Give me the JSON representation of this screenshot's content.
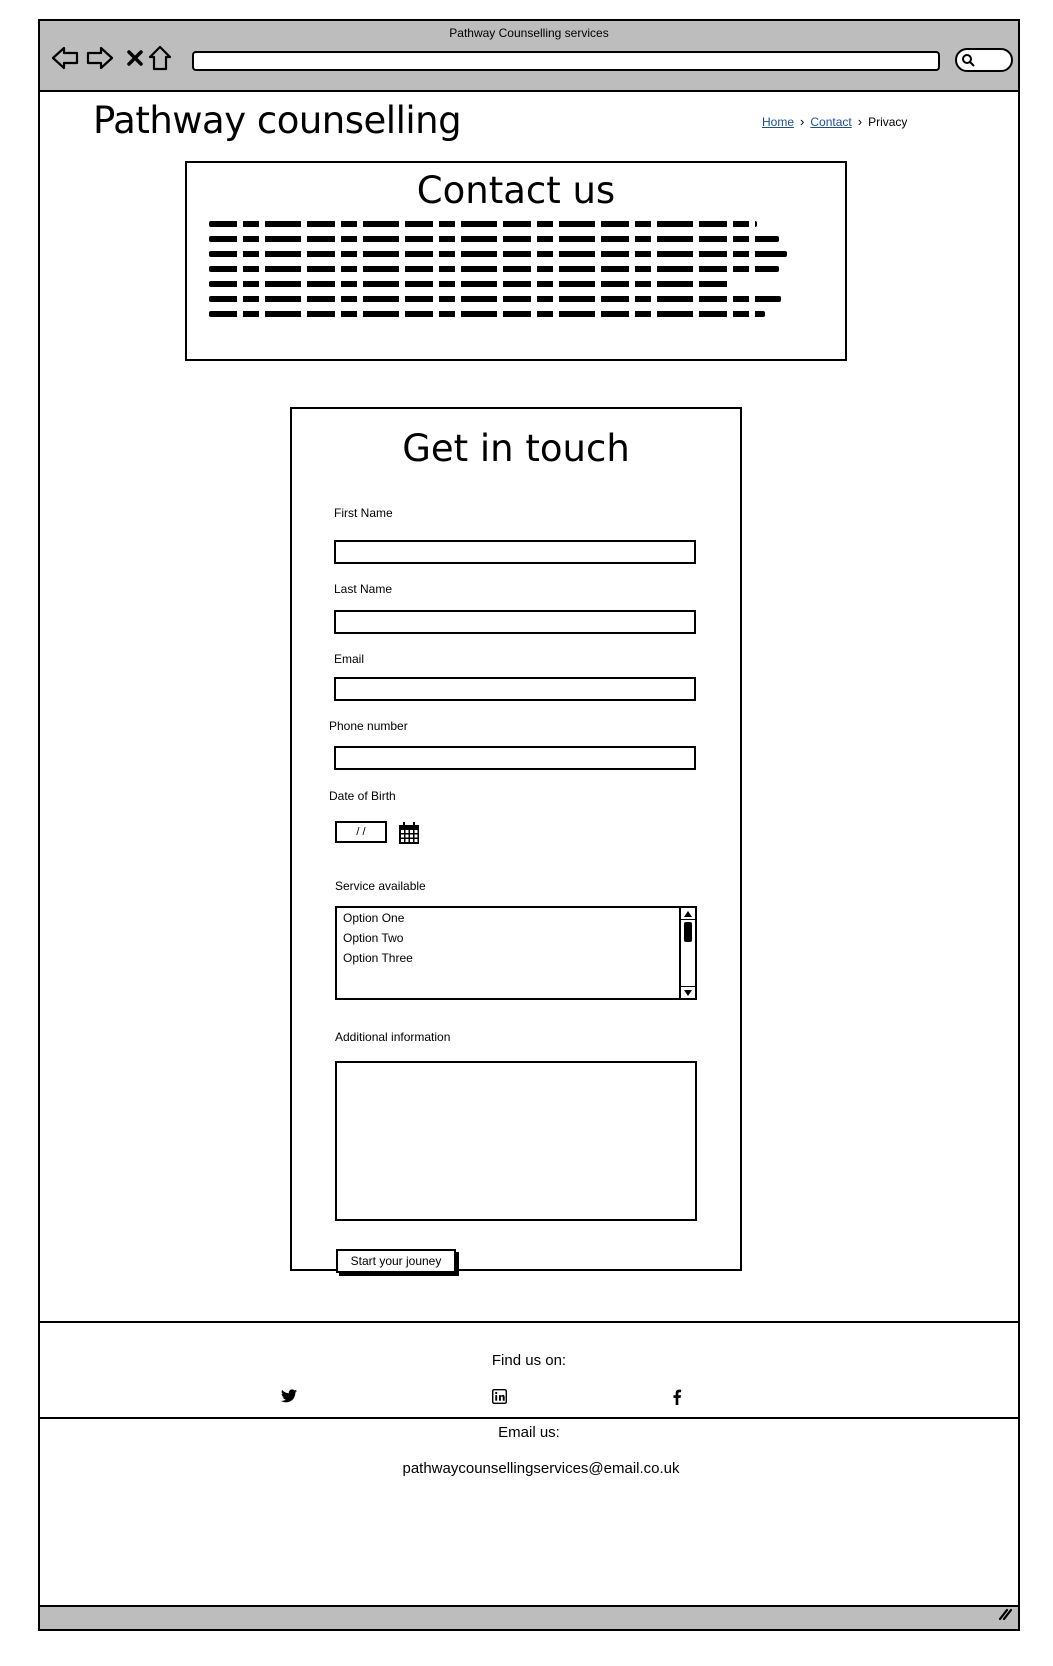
{
  "browser": {
    "window_title": "Pathway Counselling services",
    "address": "",
    "icons": [
      "back-arrow-icon",
      "forward-arrow-icon",
      "close-x-icon",
      "home-icon",
      "search-icon"
    ]
  },
  "header": {
    "site_title": "Pathway counselling",
    "breadcrumb": {
      "home": "Home",
      "contact": "Contact",
      "current": "Privacy",
      "separator": "›"
    }
  },
  "contact": {
    "title": "Contact us"
  },
  "form": {
    "title": "Get in touch",
    "first_name_label": "First Name",
    "last_name_label": "Last Name",
    "email_label": "Email",
    "phone_label": "Phone number",
    "dob_label": "Date of Birth",
    "dob_value": "/ /",
    "service_label": "Service available",
    "service_options": [
      "Option One",
      "Option Two",
      "Option Three"
    ],
    "additional_label": "Additional information",
    "submit_label": "Start your jouney"
  },
  "footer": {
    "find_us": "Find us on:",
    "social_icons": [
      "twitter-icon",
      "linkedin-icon",
      "facebook-icon"
    ],
    "email_heading": "Email us:",
    "email_address": "pathwaycounsellingservices@email.co.uk"
  },
  "colors": {
    "chrome": "#bdbdbd",
    "link": "#1a4fa0",
    "border": "#000000"
  }
}
